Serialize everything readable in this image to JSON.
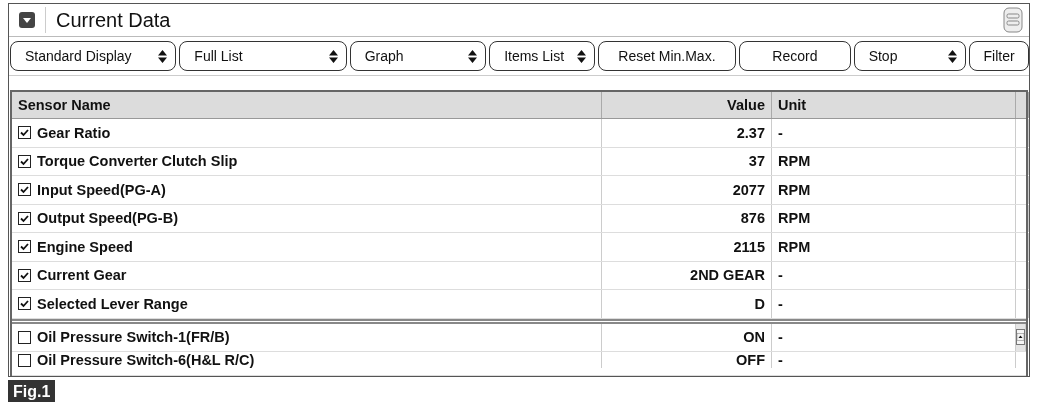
{
  "panel": {
    "title": "Current Data"
  },
  "toolbar": [
    {
      "label": "Standard Display",
      "dropdown": true
    },
    {
      "label": "Full List",
      "dropdown": true
    },
    {
      "label": "Graph",
      "dropdown": true
    },
    {
      "label": "Items List",
      "dropdown": true
    },
    {
      "label": "Reset Min.Max.",
      "dropdown": false
    },
    {
      "label": "Record",
      "dropdown": false
    },
    {
      "label": "Stop",
      "dropdown": true
    },
    {
      "label": "Filter",
      "dropdown": false
    }
  ],
  "table": {
    "columns": [
      "Sensor Name",
      "Value",
      "Unit"
    ],
    "groups": [
      {
        "rows": [
          {
            "name": "Gear Ratio",
            "value": "2.37",
            "unit": "-",
            "checked": true
          },
          {
            "name": "Torque Converter Clutch Slip",
            "value": "37",
            "unit": "RPM",
            "checked": true
          },
          {
            "name": "Input Speed(PG-A)",
            "value": "2077",
            "unit": "RPM",
            "checked": true
          },
          {
            "name": "Output Speed(PG-B)",
            "value": "876",
            "unit": "RPM",
            "checked": true
          },
          {
            "name": "Engine Speed",
            "value": "2115",
            "unit": "RPM",
            "checked": true
          },
          {
            "name": "Current Gear",
            "value": "2ND GEAR",
            "unit": "-",
            "checked": true
          },
          {
            "name": "Selected Lever Range",
            "value": "D",
            "unit": "-",
            "checked": true
          }
        ]
      },
      {
        "rows": [
          {
            "name": "Oil Pressure Switch-1(FR/B)",
            "value": "ON",
            "unit": "-",
            "checked": false
          },
          {
            "name": "Oil Pressure Switch-6(H&L R/C)",
            "value": "OFF",
            "unit": "-",
            "checked": false
          }
        ]
      }
    ]
  },
  "figure_label": "Fig.1"
}
